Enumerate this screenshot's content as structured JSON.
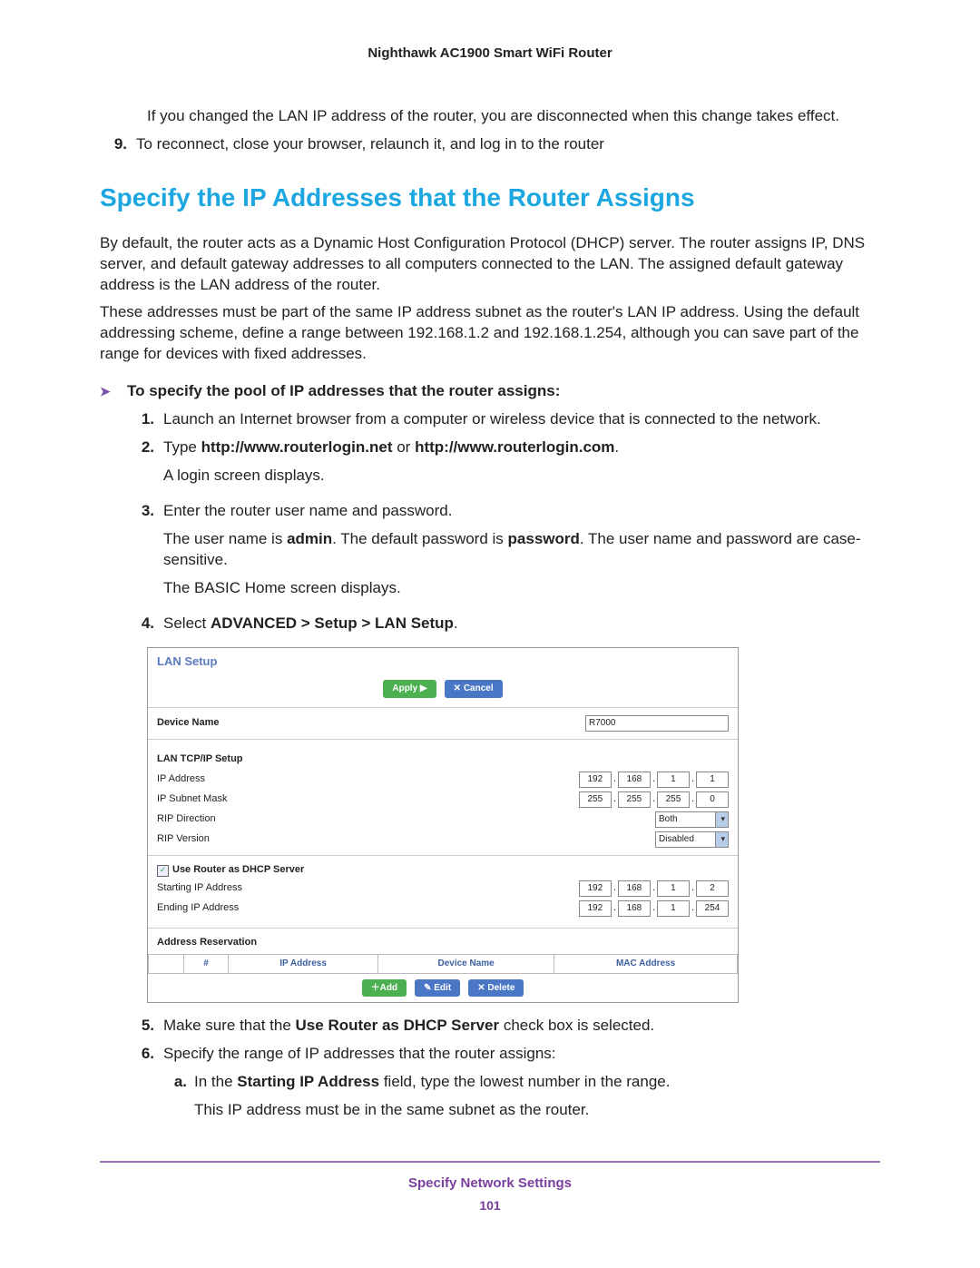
{
  "header": {
    "title": "Nighthawk AC1900 Smart WiFi Router"
  },
  "intro": {
    "p1": "If you changed the LAN IP address of the router, you are disconnected when this change takes effect.",
    "step9_num": "9.",
    "step9": "To reconnect, close your browser, relaunch it, and log in to the router"
  },
  "section": {
    "heading": "Specify the IP Addresses that the Router Assigns",
    "p1": "By default, the router acts as a Dynamic Host Configuration Protocol (DHCP) server. The router assigns IP, DNS server, and default gateway addresses to all computers connected to the LAN. The assigned default gateway address is the LAN address of the router.",
    "p2": "These addresses must be part of the same IP address subnet as the router's LAN IP address. Using the default addressing scheme, define a range between 192.168.1.2 and 192.168.1.254, although you can save part of the range for devices with fixed addresses."
  },
  "procedure": {
    "title": "To specify the pool of IP addresses that the router assigns:",
    "s1_num": "1.",
    "s1": "Launch an Internet browser from a computer or wireless device that is connected to the network.",
    "s2_num": "2.",
    "s2_pre": "Type ",
    "s2_b1": "http://www.routerlogin.net",
    "s2_mid": " or ",
    "s2_b2": "http://www.routerlogin.com",
    "s2_post": ".",
    "s2_p2": "A login screen displays.",
    "s3_num": "3.",
    "s3_l1": "Enter the router user name and password.",
    "s3_l2a": "The user name is ",
    "s3_l2b": "admin",
    "s3_l2c": ". The default password is ",
    "s3_l2d": "password",
    "s3_l2e": ". The user name and password are case-sensitive.",
    "s3_l3": "The BASIC Home screen displays.",
    "s4_num": "4.",
    "s4_pre": "Select ",
    "s4_b": "ADVANCED > Setup > LAN Setup",
    "s4_post": ".",
    "s5_num": "5.",
    "s5_pre": "Make sure that the ",
    "s5_b": "Use Router as DHCP Server",
    "s5_post": " check box is selected.",
    "s6_num": "6.",
    "s6": "Specify the range of IP addresses that the router assigns:",
    "s6a_letter": "a.",
    "s6a_pre": "In the ",
    "s6a_b": "Starting IP Address",
    "s6a_post": " field, type the lowest number in the range.",
    "s6a_p2": "This IP address must be in the same subnet as the router."
  },
  "lan_screenshot": {
    "title": "LAN Setup",
    "apply": "Apply ▶",
    "cancel": "✕ Cancel",
    "device_name_label": "Device Name",
    "device_name_value": "R7000",
    "tcpip_label": "LAN TCP/IP Setup",
    "ip_address_label": "IP Address",
    "ip_address": [
      "192",
      "168",
      "1",
      "1"
    ],
    "subnet_label": "IP Subnet Mask",
    "subnet": [
      "255",
      "255",
      "255",
      "0"
    ],
    "rip_dir_label": "RIP Direction",
    "rip_dir_value": "Both",
    "rip_ver_label": "RIP Version",
    "rip_ver_value": "Disabled",
    "dhcp_check_label": "Use Router as DHCP Server",
    "start_ip_label": "Starting IP Address",
    "start_ip": [
      "192",
      "168",
      "1",
      "2"
    ],
    "end_ip_label": "Ending IP Address",
    "end_ip": [
      "192",
      "168",
      "1",
      "254"
    ],
    "reservation_label": "Address Reservation",
    "th_num": "#",
    "th_ip": "IP Address",
    "th_dev": "Device Name",
    "th_mac": "MAC Address",
    "add": "＋Add",
    "edit": "✎ Edit",
    "delete": "✕ Delete"
  },
  "footer": {
    "section": "Specify Network Settings",
    "page": "101"
  }
}
